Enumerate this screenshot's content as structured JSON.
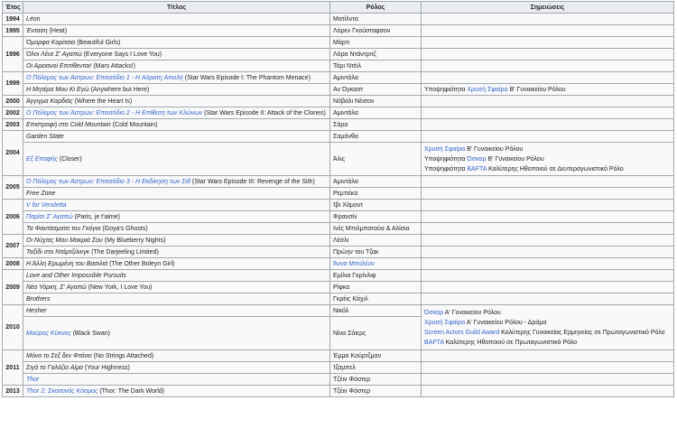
{
  "headers": {
    "year": "Έτος",
    "title": "Τίτλος",
    "role": "Ρόλος",
    "notes": "Σημειώσεις"
  },
  "colors": {
    "link": "#3366cc",
    "border": "#a2a9b1",
    "header_bg": "#eaecf0"
  },
  "rows": [
    {
      "year": "1994",
      "year_span": 1,
      "title_gr": "Léon",
      "title_en": "",
      "title_link": false,
      "role": "Ματίλντα",
      "role_link": false,
      "note_span": 1,
      "notes": []
    },
    {
      "year": "1995",
      "year_span": 1,
      "title_gr": "Ένταση",
      "title_en": "(Heat)",
      "title_link": false,
      "role": "Λόρεν Γκούσταφσον",
      "role_link": false,
      "note_span": 1,
      "notes": []
    },
    {
      "year": "1996",
      "year_span": 3,
      "title_gr": "Όμορφα Κορίτσια",
      "title_en": "(Beautiful Girls)",
      "title_link": false,
      "role": "Μάρτι",
      "role_link": false,
      "note_span": 1,
      "notes": []
    },
    {
      "title_gr": "Όλοι Λένε Σ' Αγαπώ",
      "title_en": "(Everyone Says I Love You)",
      "title_link": false,
      "role": "Λόρα Ντάντριτζ",
      "role_link": false,
      "note_span": 1,
      "notes": []
    },
    {
      "title_gr": "Οι Αρειανοί Επιτίθενται!",
      "title_en": "(Mars Attacks!)",
      "title_link": false,
      "role": "Τάρι Ντέιλ",
      "role_link": false,
      "note_span": 1,
      "notes": []
    },
    {
      "year": "1999",
      "year_span": 2,
      "title_gr": "Ο Πόλεμος των Άστρων: Επεισόδιο 1 - Η Αόρατη Απειλή",
      "title_en": "(Star Wars Episode I: The Phantom Menace)",
      "title_link": true,
      "role": "Αμιντάλα",
      "role_link": false,
      "note_span": 1,
      "notes": []
    },
    {
      "title_gr": "Η Μητέρα Μου Κι Εγώ",
      "title_en": "(Anywhere but Here)",
      "title_link": false,
      "role": "Αν Ώγκαστ",
      "role_link": false,
      "note_span": 1,
      "notes": [
        {
          "pre": "Υποψηφιότητα ",
          "link": "Χρυσή Σφαίρα",
          "post": " Β' Γυναικείου Ρόλου"
        }
      ]
    },
    {
      "year": "2000",
      "year_span": 1,
      "title_gr": "Άγγιγμα Καρδιάς",
      "title_en": "(Where the Heart Is)",
      "title_link": false,
      "role": "Νόβαλι Νέισον",
      "role_link": false,
      "note_span": 1,
      "notes": []
    },
    {
      "year": "2002",
      "year_span": 1,
      "title_gr": "Ο Πόλεμος των Άστρων: Επεισόδιο 2 - Η Επίθεση των Κλώνων",
      "title_en": "(Star Wars Episode II: Attack of the Clones)",
      "title_link": true,
      "role": "Αμιντάλα",
      "role_link": false,
      "note_span": 1,
      "notes": []
    },
    {
      "year": "2003",
      "year_span": 1,
      "title_gr": "Επιστροφή στο Cold Mountain",
      "title_en": "(Cold Mountain)",
      "title_link": false,
      "role": "Σάρα",
      "role_link": false,
      "note_span": 1,
      "notes": []
    },
    {
      "year": "2004",
      "year_span": 2,
      "title_gr": "Garden State",
      "title_en": "",
      "title_link": false,
      "role": "Σαμάνθα",
      "role_link": false,
      "note_span": 1,
      "notes": []
    },
    {
      "title_gr": "Εξ Επαφής",
      "title_en": "(Closer)",
      "title_link": true,
      "role": "Άλις",
      "role_link": false,
      "note_span": 1,
      "tall": true,
      "notes": [
        {
          "pre": "",
          "link": "Χρυσή Σφαίρα",
          "post": " Β' Γυναικείου Ρόλου"
        },
        {
          "pre": "Υποψηφιότητα ",
          "link": "Όσκαρ",
          "post": " Β' Γυναικείου Ρόλου"
        },
        {
          "pre": "Υποψηφιότητα ",
          "link": "BAFTA",
          "post": " Καλύτερης Ηθοποιού σε Δευτεραγωνιστικό Ρόλο"
        }
      ]
    },
    {
      "year": "2005",
      "year_span": 2,
      "title_gr": "Ο Πόλεμος των Άστρων: Επεισόδιο 3 - Η Εκδίκηση των Σιθ",
      "title_en": "(Star Wars Episode III: Revenge of the Sith)",
      "title_link": true,
      "role": "Αμιντάλα",
      "role_link": false,
      "note_span": 1,
      "notes": []
    },
    {
      "title_gr": "Free Zone",
      "title_en": "",
      "title_link": false,
      "role": "Ρεμπέκα",
      "role_link": false,
      "note_span": 1,
      "notes": []
    },
    {
      "year": "2006",
      "year_span": 3,
      "title_gr": "V for Vendetta",
      "title_en": "",
      "title_link": true,
      "role": "Ίβι Χάμοντ",
      "role_link": false,
      "note_span": 1,
      "notes": []
    },
    {
      "title_gr": "Παρίσι Σ' Αγαπώ",
      "title_en": "(Paris, je t'aime)",
      "title_link": true,
      "role": "Φρανσίν",
      "role_link": false,
      "note_span": 1,
      "notes": []
    },
    {
      "title_gr": "Τα Φαντάσματα του Γκόγια",
      "title_en": "(Goya's Ghosts)",
      "title_link": false,
      "role": "Ινές Μπιλμπατούα & Αλίσια",
      "role_link": false,
      "note_span": 1,
      "notes": []
    },
    {
      "year": "2007",
      "year_span": 2,
      "title_gr": "Οι Νύχτες Μου Μακριά Σου",
      "title_en": "(My Blueberry Nights)",
      "title_link": false,
      "role": "Λέσλι",
      "role_link": false,
      "note_span": 1,
      "notes": []
    },
    {
      "title_gr": "Ταξίδι στο Ντάρτζιλινγκ",
      "title_en": "(The Darjeeling Limited)",
      "title_link": false,
      "role": "Πρώην του Τζακ",
      "role_link": false,
      "note_span": 1,
      "notes": []
    },
    {
      "year": "2008",
      "year_span": 1,
      "title_gr": "Η Άλλη Ερωμένη του Βασιλιά",
      "title_en": "(The Other Boleyn Girl)",
      "title_link": false,
      "role": "Άννα Μπολέυν",
      "role_link": true,
      "note_span": 1,
      "notes": []
    },
    {
      "year": "2009",
      "year_span": 3,
      "title_gr": "Love and Other Impossible Pursuits",
      "title_en": "",
      "title_link": false,
      "role": "Εμίλια Γκρίνλιφ",
      "role_link": false,
      "note_span": 1,
      "notes": []
    },
    {
      "title_gr": "Νέα Υόρκη, Σ' Αγαπώ",
      "title_en": "(New York, I Love You)",
      "title_link": false,
      "role": "Ρίφκα",
      "role_link": false,
      "note_span": 1,
      "notes": []
    },
    {
      "title_gr": "Brothers",
      "title_en": "",
      "title_link": false,
      "role": "Γκρέις Κάχιλ",
      "role_link": false,
      "note_span": 1,
      "notes": []
    },
    {
      "year": "2010",
      "year_span": 2,
      "title_gr": "Hesher",
      "title_en": "",
      "title_link": false,
      "role": "Νικόλ",
      "role_link": false,
      "note_span": 2,
      "notes": [
        {
          "pre": "",
          "link": "Όσκαρ",
          "post": " Α' Γυναικείου Ρόλου"
        },
        {
          "pre": "",
          "link": "Χρυσή Σφαίρα",
          "post": " Α' Γυναικείου Ρόλου - Δράμα"
        },
        {
          "pre": "",
          "link": "Screen Actors Guild Award",
          "post": " Καλύτερης Γυναικείας Ερμηνείας σε Πρωταγωνιστικό Ρόλο"
        },
        {
          "pre": "",
          "link": "BAFTA",
          "post": " Καλύτερης Ηθοποιού σε Πρωταγωνιστικό Ρόλο"
        }
      ]
    },
    {
      "title_gr": "Μαύρος Κύκνος",
      "title_en": "(Black Swan)",
      "title_link": true,
      "role": "Νίνα Σάιερς",
      "role_link": false,
      "tall2": true
    },
    {
      "year": "2011",
      "year_span": 3,
      "title_gr": "Μόνο το Σεξ δεν Φτάνει",
      "title_en": "(No Strings Attached)",
      "title_link": false,
      "role": "Έμμα Κούρτζμαν",
      "role_link": false,
      "note_span": 1,
      "notes": []
    },
    {
      "title_gr": "Σιγά το Γαλάζιο Αίμα",
      "title_en": "(Your Highness)",
      "title_link": false,
      "role": "Ίζαμπελ",
      "role_link": false,
      "note_span": 1,
      "notes": []
    },
    {
      "title_gr": "Thor",
      "title_en": "",
      "title_link": true,
      "role": "Τζέιν Φόστερ",
      "role_link": false,
      "note_span": 1,
      "notes": []
    },
    {
      "year": "2013",
      "year_span": 1,
      "title_gr": "Thor 2: Σκοτεινός Κόσμος",
      "title_en": "(Thor: The Dark World)",
      "title_link": true,
      "role": "Τζέιν Φόστερ",
      "role_link": false,
      "note_span": 1,
      "notes": []
    }
  ]
}
